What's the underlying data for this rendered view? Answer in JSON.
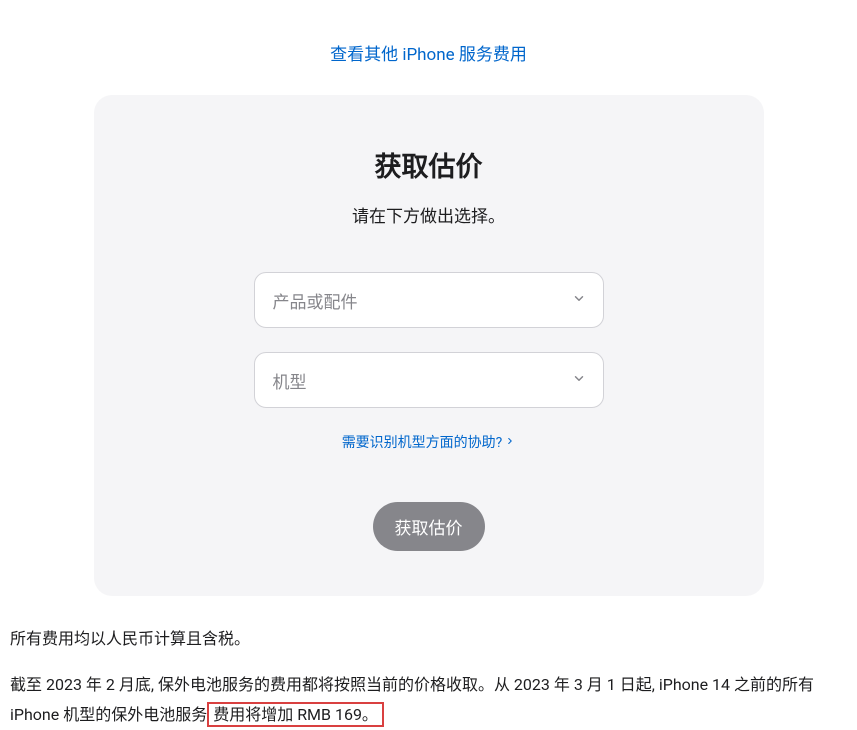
{
  "top_link": "查看其他 iPhone 服务费用",
  "card": {
    "title": "获取估价",
    "subtitle": "请在下方做出选择。",
    "select1_placeholder": "产品或配件",
    "select2_placeholder": "机型",
    "help_link": "需要识别机型方面的协助?",
    "submit_label": "获取估价"
  },
  "footer": {
    "line1": "所有费用均以人民币计算且含税。",
    "line2_pre": "截至 2023 年 2 月底, 保外电池服务的费用都将按照当前的价格收取。从 2023 年 3 月 1 日起, iPhone 14 之前的所有 iPhone 机型的保外电池服务",
    "line2_highlight": "费用将增加 RMB 169。"
  }
}
